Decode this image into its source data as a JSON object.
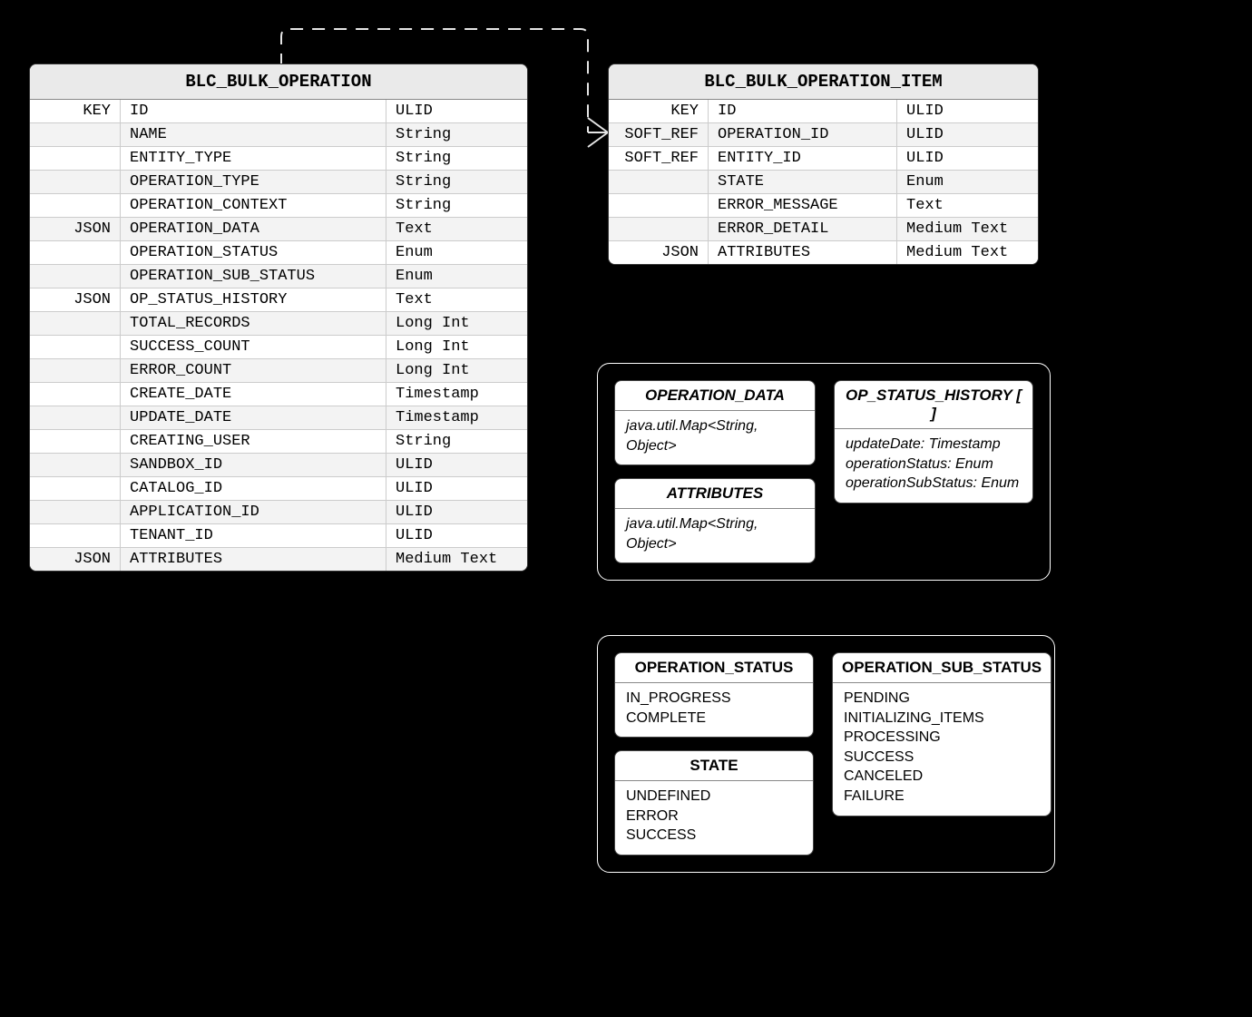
{
  "tables": {
    "bulk_operation": {
      "title": "BLC_BULK_OPERATION",
      "rows": [
        {
          "a": "KEY",
          "b": "ID",
          "c": "ULID"
        },
        {
          "a": "",
          "b": "NAME",
          "c": "String"
        },
        {
          "a": "",
          "b": "ENTITY_TYPE",
          "c": "String"
        },
        {
          "a": "",
          "b": "OPERATION_TYPE",
          "c": "String"
        },
        {
          "a": "",
          "b": "OPERATION_CONTEXT",
          "c": "String"
        },
        {
          "a": "JSON",
          "b": "OPERATION_DATA",
          "c": "Text"
        },
        {
          "a": "",
          "b": "OPERATION_STATUS",
          "c": "Enum"
        },
        {
          "a": "",
          "b": "OPERATION_SUB_STATUS",
          "c": "Enum"
        },
        {
          "a": "JSON",
          "b": "OP_STATUS_HISTORY",
          "c": "Text"
        },
        {
          "a": "",
          "b": "TOTAL_RECORDS",
          "c": "Long Int"
        },
        {
          "a": "",
          "b": "SUCCESS_COUNT",
          "c": "Long Int"
        },
        {
          "a": "",
          "b": "ERROR_COUNT",
          "c": "Long Int"
        },
        {
          "a": "",
          "b": "CREATE_DATE",
          "c": "Timestamp"
        },
        {
          "a": "",
          "b": "UPDATE_DATE",
          "c": "Timestamp"
        },
        {
          "a": "",
          "b": "CREATING_USER",
          "c": "String"
        },
        {
          "a": "",
          "b": "SANDBOX_ID",
          "c": "ULID"
        },
        {
          "a": "",
          "b": "CATALOG_ID",
          "c": "ULID"
        },
        {
          "a": "",
          "b": "APPLICATION_ID",
          "c": "ULID"
        },
        {
          "a": "",
          "b": "TENANT_ID",
          "c": "ULID"
        },
        {
          "a": "JSON",
          "b": "ATTRIBUTES",
          "c": "Medium Text"
        }
      ]
    },
    "bulk_operation_item": {
      "title": "BLC_BULK_OPERATION_ITEM",
      "rows": [
        {
          "a": "KEY",
          "b": "ID",
          "c": "ULID"
        },
        {
          "a": "SOFT_REF",
          "b": "OPERATION_ID",
          "c": "ULID"
        },
        {
          "a": "SOFT_REF",
          "b": "ENTITY_ID",
          "c": "ULID"
        },
        {
          "a": "",
          "b": "STATE",
          "c": "Enum"
        },
        {
          "a": "",
          "b": "ERROR_MESSAGE",
          "c": "Text"
        },
        {
          "a": "",
          "b": "ERROR_DETAIL",
          "c": "Medium Text"
        },
        {
          "a": "JSON",
          "b": "ATTRIBUTES",
          "c": "Medium Text"
        }
      ]
    }
  },
  "types_panel": {
    "operation_data": {
      "title": "OPERATION_DATA",
      "body": "java.util.Map<String, Object>"
    },
    "attributes": {
      "title": "ATTRIBUTES",
      "body": "java.util.Map<String, Object>"
    },
    "op_status_history": {
      "title": "OP_STATUS_HISTORY [ ]",
      "lines": [
        "updateDate: Timestamp",
        "operationStatus: Enum",
        "operationSubStatus: Enum"
      ]
    }
  },
  "enums_panel": {
    "operation_status": {
      "title": "OPERATION_STATUS",
      "values": [
        "IN_PROGRESS",
        "COMPLETE"
      ]
    },
    "state": {
      "title": "STATE",
      "values": [
        "UNDEFINED",
        "ERROR",
        "SUCCESS"
      ]
    },
    "operation_sub_status": {
      "title": "OPERATION_SUB_STATUS",
      "values": [
        "PENDING",
        "INITIALIZING_ITEMS",
        "PROCESSING",
        "SUCCESS",
        "CANCELED",
        "FAILURE"
      ]
    }
  }
}
